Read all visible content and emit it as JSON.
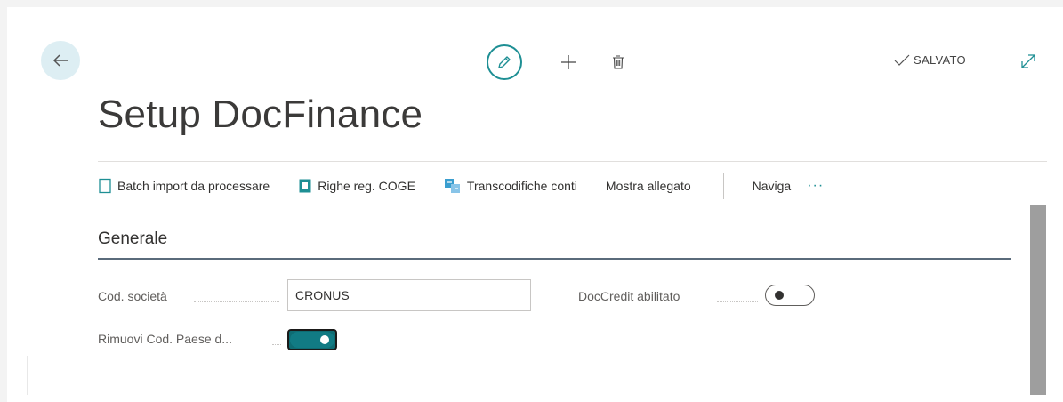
{
  "header": {
    "saved_label": "SALVATO"
  },
  "page": {
    "title": "Setup DocFinance"
  },
  "actions": [
    {
      "label": "Batch import da processare",
      "icon": "document-outline-icon"
    },
    {
      "label": "Righe reg. COGE",
      "icon": "ledger-icon"
    },
    {
      "label": "Transcodifiche conti",
      "icon": "transcode-icon"
    },
    {
      "label": "Mostra allegato"
    },
    {
      "label": "Naviga"
    }
  ],
  "more_label": "···",
  "section": {
    "title": "Generale"
  },
  "fields": {
    "cod_societa": {
      "label": "Cod. società",
      "value": "CRONUS"
    },
    "doccredit": {
      "label": "DocCredit abilitato",
      "checked": false
    },
    "rimuovi": {
      "label": "Rimuovi Cod. Paese d...",
      "checked": true
    }
  },
  "colors": {
    "accent": "#1e8f94",
    "toggle_on": "#117b84"
  }
}
